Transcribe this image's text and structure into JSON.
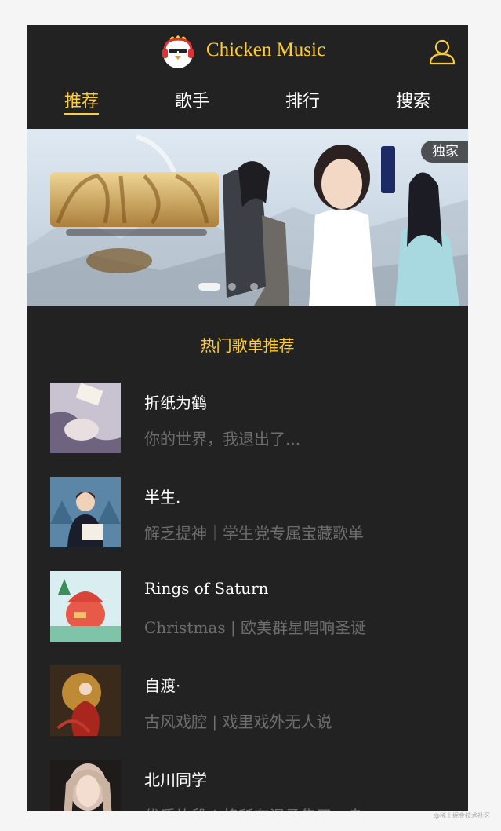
{
  "header": {
    "title": "Chicken Music"
  },
  "tabs": [
    {
      "label": "推荐",
      "active": true
    },
    {
      "label": "歌手",
      "active": false
    },
    {
      "label": "排行",
      "active": false
    },
    {
      "label": "搜索",
      "active": false
    }
  ],
  "banner": {
    "badge": "独家",
    "active_slide": 1,
    "slide_count": 3
  },
  "section_title": "热门歌单推荐",
  "playlists": [
    {
      "name": "折纸为鹤",
      "desc": "你的世界，我退出了..."
    },
    {
      "name": "半生.",
      "desc": "解乏提神｜学生党专属宝藏歌单"
    },
    {
      "name": "Rings of Saturn",
      "desc": "Christmas | 欧美群星唱响圣诞"
    },
    {
      "name": "自渡·",
      "desc": "古风戏腔 | 戏里戏外无人说"
    },
    {
      "name": "北川同学",
      "desc": "优质片段 | 将所有温柔集于一身"
    }
  ],
  "colors": {
    "accent": "#ffcd32",
    "background": "#222222",
    "muted_text": "#6e6e6e"
  },
  "icons": {
    "logo": "chicken-logo-icon",
    "user": "user-icon"
  },
  "watermark": "@稀土掘金技术社区"
}
